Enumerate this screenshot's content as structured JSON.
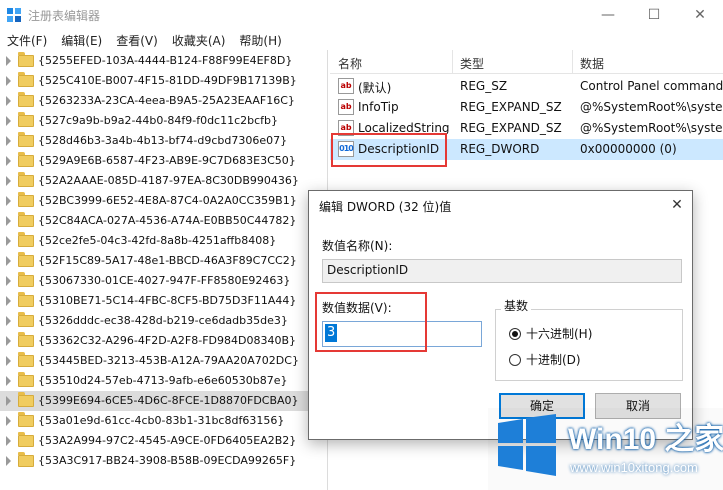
{
  "window": {
    "title": "注册表编辑器",
    "min": "—",
    "max": "☐",
    "close": "✕"
  },
  "menu": [
    "文件(F)",
    "编辑(E)",
    "查看(V)",
    "收藏夹(A)",
    "帮助(H)"
  ],
  "tree": [
    "{5255EFED-103A-4444-B124-F88F99E4EF8D}",
    "{525C410E-B007-4F15-81DD-49DF9B17139B}",
    "{5263233A-23CA-4eea-B9A5-25A23EAAF16C}",
    "{527c9a9b-b9a2-44b0-84f9-f0dc11c2bcfb}",
    "{528d46b3-3a4b-4b13-bf74-d9cbd7306e07}",
    "{529A9E6B-6587-4F23-AB9E-9C7D683E3C50}",
    "{52A2AAAE-085D-4187-97EA-8C30DB990436}",
    "{52BC3999-6E52-4E8A-87C4-0A2A0CC359B1}",
    "{52C84ACA-027A-4536-A74A-E0BB50C44782}",
    "{52ce2fe5-04c3-42fd-8a8b-4251affb8408}",
    "{52F15C89-5A17-48e1-BBCD-46A3F89C7CC2}",
    "{53067330-01CE-4027-947F-FF8580E92463}",
    "{5310BE71-5C14-4FBC-8CF5-BD75D3F11A44}",
    "{5326dddc-ec38-428d-b219-ce6dadb35de3}",
    "{53362C32-A296-4F2D-A2F8-FD984D08340B}",
    "{53445BED-3213-453B-A12A-79AA20A702DC}",
    "{53510d24-57eb-4713-9afb-e6e60530b87e}",
    "{5399E694-6CE5-4D6C-8FCE-1D8870FDCBA0}",
    "{53a01e9d-61cc-4cb0-83b1-31bc8df63156}",
    "{53A2A994-97C2-4545-A9CE-0FD6405EA2B2}",
    "{53A3C917-BB24-3908-B58B-09ECDA99265F}"
  ],
  "tree_selected_index": 17,
  "list": {
    "headers": {
      "name": "名称",
      "type": "类型",
      "data": "数据"
    },
    "rows": [
      {
        "icon": "string-value-icon",
        "glyph": "ab",
        "name": "(默认)",
        "type": "REG_SZ",
        "data": "Control Panel command"
      },
      {
        "icon": "string-value-icon",
        "glyph": "ab",
        "name": "InfoTip",
        "type": "REG_EXPAND_SZ",
        "data": "@%SystemRoot%\\syster"
      },
      {
        "icon": "string-value-icon",
        "glyph": "ab",
        "name": "LocalizedString",
        "type": "REG_EXPAND_SZ",
        "data": "@%SystemRoot%\\syster"
      },
      {
        "icon": "dword-value-icon",
        "glyph": "010",
        "name": "DescriptionID",
        "type": "REG_DWORD",
        "data": "0x00000000 (0)"
      }
    ],
    "selected_index": 3
  },
  "dialog": {
    "title": "编辑 DWORD (32 位)值",
    "close": "✕",
    "name_label": "数值名称(N):",
    "name_value": "DescriptionID",
    "data_label": "数值数据(V):",
    "data_value": "3",
    "base_label": "基数",
    "hex_label": "十六进制(H)",
    "dec_label": "十进制(D)",
    "ok": "确定",
    "cancel": "取消"
  },
  "watermark": {
    "title": "Win10 之家",
    "url": "www.win10xitong.com"
  },
  "colors": {
    "highlight": "#e53935",
    "selection": "#cce8ff",
    "accent": "#0078d7"
  }
}
